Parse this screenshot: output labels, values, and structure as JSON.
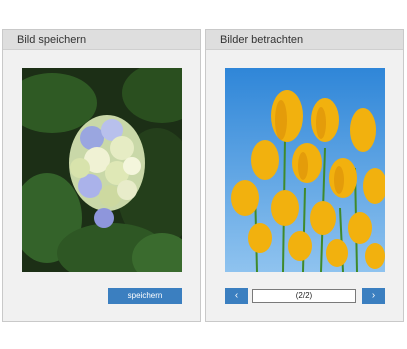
{
  "left_panel": {
    "title": "Bild speichern",
    "image_label": "hydrangea-photo",
    "save_label": "speichern"
  },
  "right_panel": {
    "title": "Bilder betrachten",
    "image_label": "tulips-photo",
    "prev_label": "‹",
    "next_label": "›",
    "counter": "(2/2)"
  },
  "colors": {
    "accent": "#3b7fc0",
    "panel_bg": "#f1f1f1",
    "header_bg": "#dedede"
  }
}
